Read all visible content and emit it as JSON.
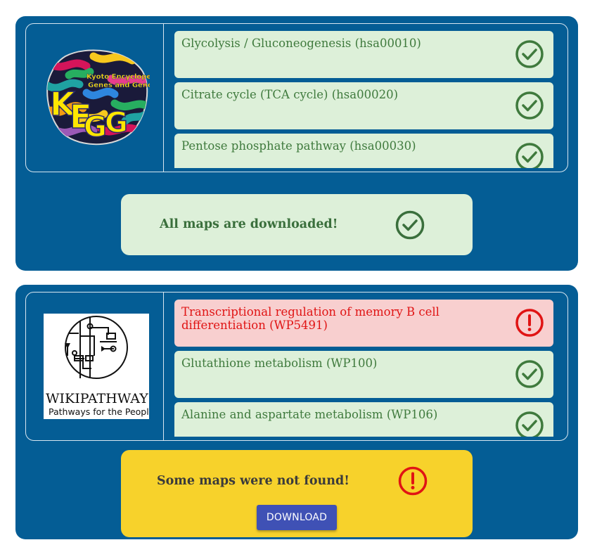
{
  "colors": {
    "panel_bg": "#045d95",
    "success_bg": "#ddf0d9",
    "success_fg": "#3f7a3d",
    "error_bg": "#f8cfcf",
    "error_fg": "#e01414",
    "warning_bg": "#f7d22b",
    "button_bg": "#3f51b5"
  },
  "kegg": {
    "logo": {
      "title": "Kyoto Encyclopedia of Genes and Genomes",
      "letters": "KEGG",
      "icon": "kegg-logo"
    },
    "items": [
      {
        "label": "Glycolysis / Gluconeogenesis (hsa00010)",
        "status": "success",
        "icon": "check-circle-icon"
      },
      {
        "label": "Citrate cycle (TCA cycle) (hsa00020)",
        "status": "success",
        "icon": "check-circle-icon"
      },
      {
        "label": "Pentose phosphate pathway (hsa00030)",
        "status": "success",
        "icon": "check-circle-icon"
      }
    ],
    "status": {
      "message": "All maps are downloaded!",
      "icon": "check-circle-icon"
    }
  },
  "wikipathways": {
    "logo": {
      "title": "WikiPathways",
      "tagline": "Pathways for the People",
      "icon": "wikipathways-logo"
    },
    "items": [
      {
        "label": "Transcriptional regulation of memory B cell differentiation (WP5491)",
        "status": "error",
        "icon": "exclamation-circle-icon"
      },
      {
        "label": "Glutathione metabolism (WP100)",
        "status": "success",
        "icon": "check-circle-icon"
      },
      {
        "label": "Alanine and aspartate metabolism (WP106)",
        "status": "success",
        "icon": "check-circle-icon"
      }
    ],
    "status": {
      "message": "Some maps were not found!",
      "icon": "exclamation-circle-icon"
    },
    "download_label": "DOWNLOAD"
  }
}
